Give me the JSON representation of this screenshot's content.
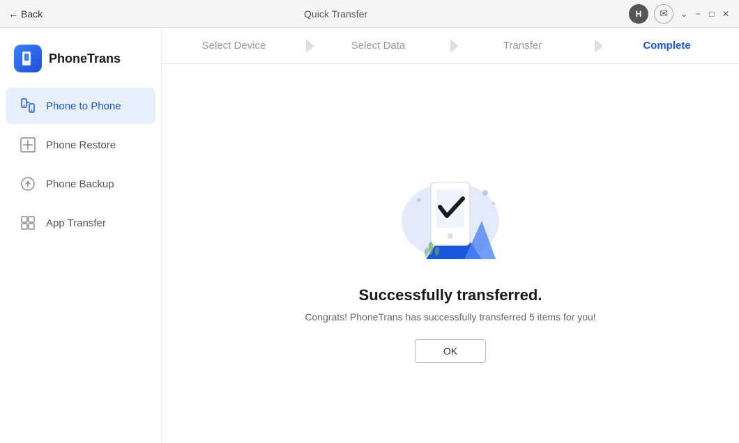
{
  "titlebar": {
    "back_label": "Back",
    "title": "Quick Transfer",
    "avatar_label": "H",
    "minimize_label": "−",
    "maximize_label": "□",
    "close_label": "✕",
    "collapse_label": "⌄"
  },
  "sidebar": {
    "logo_text": "PhoneTrans",
    "nav_items": [
      {
        "id": "phone-to-phone",
        "label": "Phone to Phone",
        "icon": "📱",
        "active": true
      },
      {
        "id": "phone-restore",
        "label": "Phone Restore",
        "icon": "⏳",
        "active": false
      },
      {
        "id": "phone-backup",
        "label": "Phone Backup",
        "icon": "🔄",
        "active": false
      },
      {
        "id": "app-transfer",
        "label": "App Transfer",
        "icon": "📦",
        "active": false
      }
    ]
  },
  "steps": [
    {
      "id": "select-device",
      "label": "Select Device",
      "state": "completed"
    },
    {
      "id": "select-data",
      "label": "Select Data",
      "state": "completed"
    },
    {
      "id": "transfer",
      "label": "Transfer",
      "state": "completed"
    },
    {
      "id": "complete",
      "label": "Complete",
      "state": "active"
    }
  ],
  "content": {
    "success_title": "Successfully transferred.",
    "success_subtitle": "Congrats! PhoneTrans has successfully transferred 5 items for you!",
    "ok_button_label": "OK"
  }
}
